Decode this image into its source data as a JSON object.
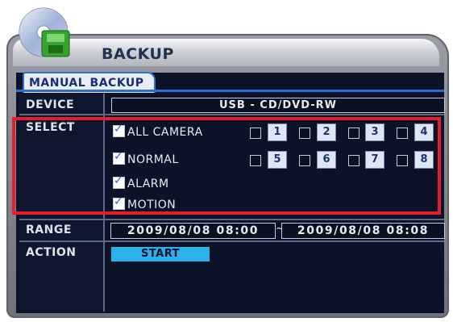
{
  "window": {
    "title": "BACKUP",
    "logo": "backup-cd-logo-icon"
  },
  "tab": {
    "label": "MANUAL BACKUP"
  },
  "device": {
    "label": "DEVICE",
    "value": "USB - CD/DVD-RW"
  },
  "select": {
    "label": "SELECT",
    "all_camera": "ALL CAMERA",
    "normal": "NORMAL",
    "alarm": "ALARM",
    "motion": "MOTION",
    "cameras_row1": [
      "1",
      "2",
      "3",
      "4"
    ],
    "cameras_row2": [
      "5",
      "6",
      "7",
      "8"
    ]
  },
  "range": {
    "label": "RANGE",
    "from": "2009/08/08  08:00",
    "sep": "~",
    "to": "2009/08/08  08:08"
  },
  "action": {
    "label": "ACTION",
    "start": "START"
  },
  "colors": {
    "highlight": "#e61e2a",
    "start_button": "#2eb1ea",
    "tab_border": "#2b6fd4"
  }
}
